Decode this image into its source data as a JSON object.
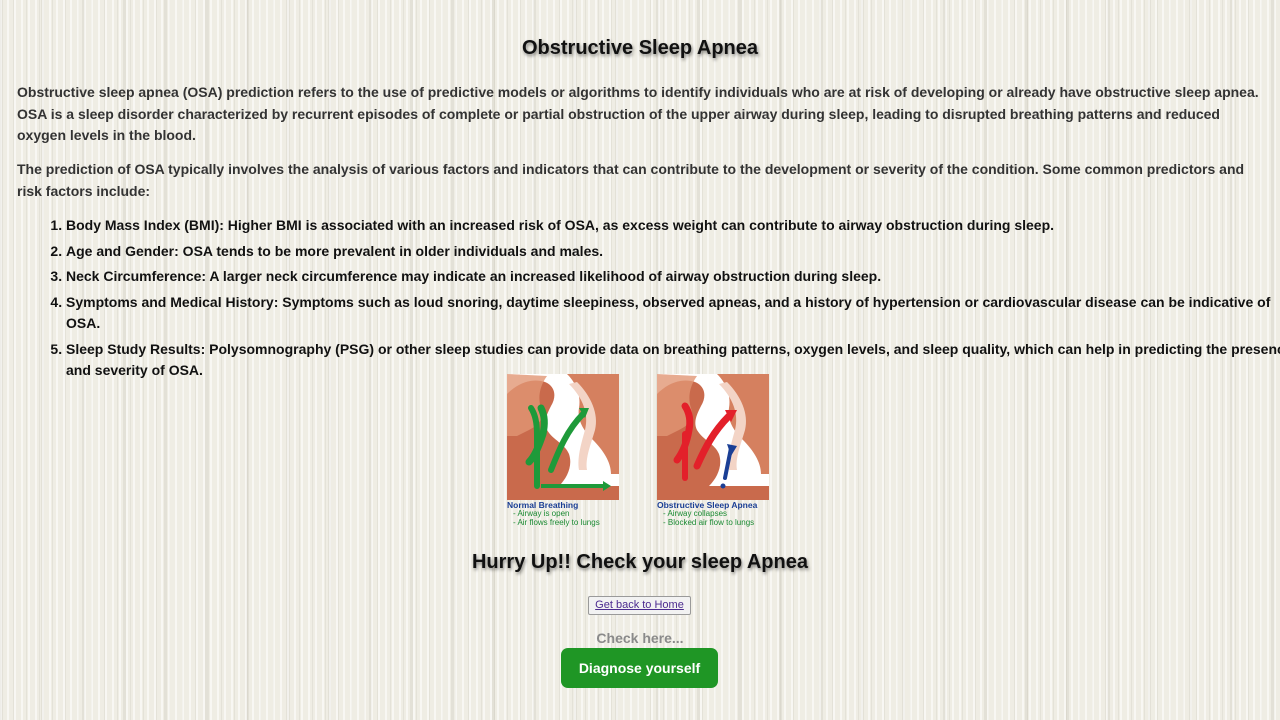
{
  "header": {
    "title": "Obstructive Sleep Apnea"
  },
  "intro": {
    "paragraph1": "Obstructive sleep apnea (OSA) prediction refers to the use of predictive models or algorithms to identify individuals who are at risk of developing or already have obstructive sleep apnea. OSA is a sleep disorder characterized by recurrent episodes of complete or partial obstruction of the upper airway during sleep, leading to disrupted breathing patterns and reduced oxygen levels in the blood.",
    "paragraph2": "The prediction of OSA typically involves the analysis of various factors and indicators that can contribute to the development or severity of the condition. Some common predictors and risk factors include:"
  },
  "factors": [
    "Body Mass Index (BMI): Higher BMI is associated with an increased risk of OSA, as excess weight can contribute to airway obstruction during sleep.",
    "Age and Gender: OSA tends to be more prevalent in older individuals and males.",
    "Neck Circumference: A larger neck circumference may indicate an increased likelihood of airway obstruction during sleep.",
    "Symptoms and Medical History: Symptoms such as loud snoring, daytime sleepiness, observed apneas, and a history of hypertension or cardiovascular disease can be indicative of OSA.",
    "Sleep Study Results: Polysomnography (PSG) or other sleep studies can provide data on breathing patterns, oxygen levels, and sleep quality, which can help in predicting the presence and severity of OSA."
  ],
  "figures": {
    "normal": {
      "caption": "Normal Breathing",
      "line1": "- Airway is open",
      "line2": "- Air flows freely to lungs",
      "arrow_color": "#1e9a3a"
    },
    "osa": {
      "caption": "Obstructive Sleep Apnea",
      "line1": "- Airway collapses",
      "line2": "- Blocked air flow to lungs",
      "arrow_color": "#e3202a"
    }
  },
  "cta": {
    "heading": "Hurry Up!! Check your sleep Apnea",
    "home_label": "Get back to Home",
    "check_label": "Check here...",
    "diagnose_label": "Diagnose yourself",
    "accent_color": "#1f9625"
  }
}
